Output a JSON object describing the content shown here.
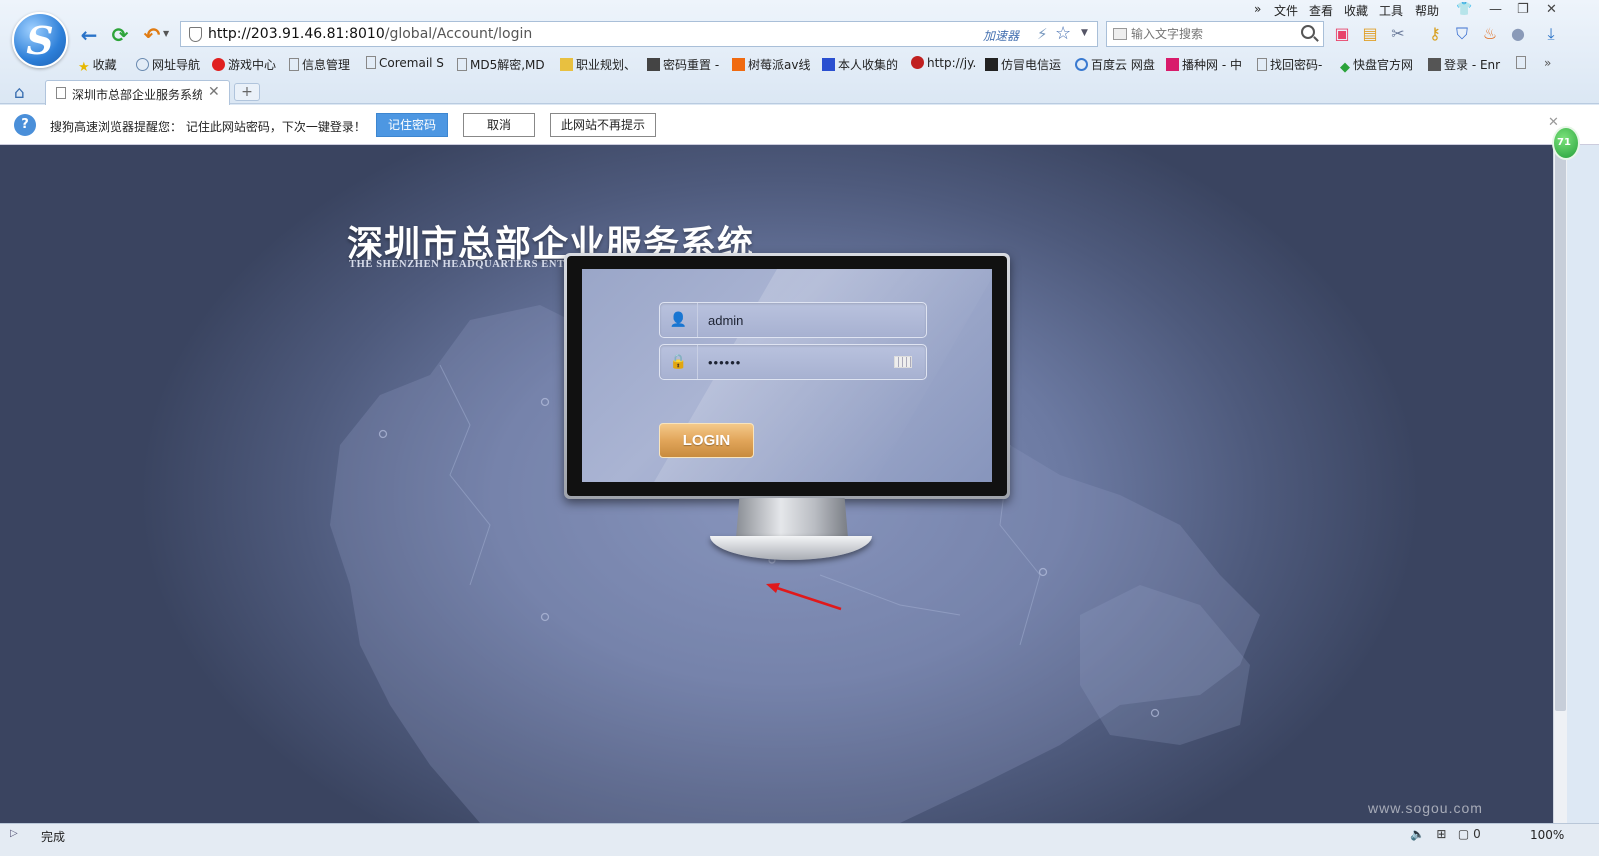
{
  "browser": {
    "url_host": "http://203.91.46.81:8010",
    "url_path": "/global/Account/login",
    "accelerator_label": "加速器",
    "search_placeholder": "输入文字搜索",
    "menu": [
      "»",
      "文件",
      "查看",
      "收藏",
      "工具",
      "帮助"
    ],
    "bookmarks": [
      {
        "label": "收藏",
        "icon": "star-icon"
      },
      {
        "label": "网址导航",
        "icon": "globe-icon"
      },
      {
        "label": "游戏中心",
        "icon": "game-icon"
      },
      {
        "label": "信息管理",
        "icon": "page-icon"
      },
      {
        "label": "Coremail S",
        "icon": "page-icon"
      },
      {
        "label": "MD5解密,MD",
        "icon": "page-icon"
      },
      {
        "label": "职业规划、",
        "icon": "pen-icon"
      },
      {
        "label": "密码重置 -",
        "icon": "site-icon"
      },
      {
        "label": "树莓派av线",
        "icon": "taobao-icon"
      },
      {
        "label": "本人收集的",
        "icon": "baidu-icon"
      },
      {
        "label": "http://jy.",
        "icon": "site-icon"
      },
      {
        "label": "仿冒电信运",
        "icon": "site-icon"
      },
      {
        "label": "百度云 网盘",
        "icon": "cloud-icon"
      },
      {
        "label": "播种网 - 中",
        "icon": "site-icon"
      },
      {
        "label": "找回密码-",
        "icon": "page-icon"
      },
      {
        "label": "快盘官方网",
        "icon": "diamond-icon"
      },
      {
        "label": "登录 - Enr",
        "icon": "site-icon"
      }
    ],
    "tab_label": "深圳市总部企业服务系统",
    "new_tab_label": "+",
    "notification": {
      "text": "搜狗高速浏览器提醒您： 记住此网站密码，下次一键登录！",
      "remember_label": "记住密码",
      "cancel_label": "取消",
      "never_label": "此网站不再提示"
    },
    "status": "完成",
    "zoom": "100%",
    "side_badge": "71"
  },
  "page": {
    "title_cn": "深圳市总部企业服务系统",
    "title_en": "THE SHENZHEN HEADQUARTERS ENTERPRISE SERVICE SYSTEM",
    "username_value": "admin",
    "password_mask": "••••••",
    "login_label": "LOGIN"
  },
  "watermark": "www.sogou.com",
  "colors": {
    "login_button": "#e1a55a",
    "annotation_arrow": "#e0191b",
    "page_background": "#6c7aa2"
  }
}
